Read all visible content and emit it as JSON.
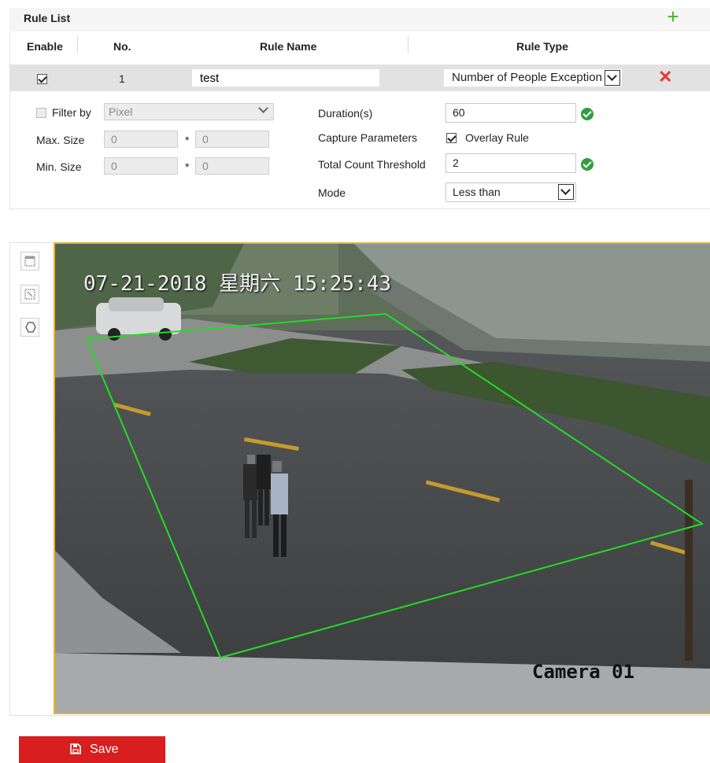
{
  "rule_list": {
    "title": "Rule List",
    "add_icon": "plus-icon",
    "columns": {
      "enable": "Enable",
      "no": "No.",
      "rule_name": "Rule Name",
      "rule_type": "Rule Type"
    },
    "rows": [
      {
        "enabled": true,
        "no": "1",
        "name": "test",
        "type": "Number of People Exception"
      }
    ]
  },
  "params": {
    "filter_by": {
      "label": "Filter by",
      "checked": false,
      "value": "Pixel"
    },
    "max_size": {
      "label": "Max. Size",
      "w": "0",
      "sep": "*",
      "h": "0"
    },
    "min_size": {
      "label": "Min. Size",
      "w": "0",
      "sep": "*",
      "h": "0"
    },
    "duration": {
      "label": "Duration(s)",
      "value": "60"
    },
    "capture": {
      "label": "Capture Parameters",
      "overlay_label": "Overlay Rule",
      "overlay_checked": true
    },
    "threshold": {
      "label": "Total Count Threshold",
      "value": "2"
    },
    "mode": {
      "label": "Mode",
      "value": "Less than"
    }
  },
  "video": {
    "osd_datetime": "07-21-2018 星期六 15:25:43",
    "osd_camera": "Camera 01",
    "region_color": "#22dd22",
    "tools": [
      "draw-area-icon",
      "clear-area-icon",
      "polygon-icon"
    ]
  },
  "actions": {
    "save_label": "Save",
    "save_icon": "floppy-disk-icon"
  },
  "colors": {
    "accent": "#d81e1e",
    "ok": "#2e9e3e",
    "add": "#4caf2a"
  }
}
